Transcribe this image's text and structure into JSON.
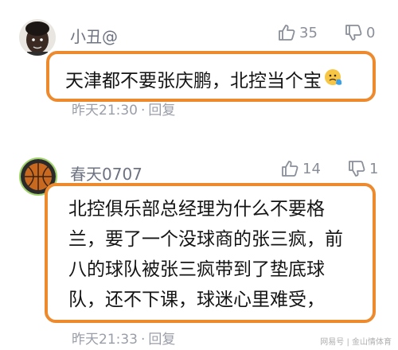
{
  "comments": [
    {
      "username": "小丑@",
      "like_count": "35",
      "dislike_count": "0",
      "text": "天津都不要张庆鹏，北控当个宝",
      "time": "昨天21:30",
      "dot": "·",
      "reply_label": "回复"
    },
    {
      "username": "春天0707",
      "like_count": "14",
      "dislike_count": "1",
      "text": "北控俱乐部总经理为什么不要格\n兰，要了一个没球商的张三疯，前\n八的球队被张三疯带到了垫底球\n队，还不下课，球迷心里难受，",
      "time": "昨天21:33",
      "dot": "·",
      "reply_label": "回复"
    }
  ],
  "watermark": "网易号 | 金山情体育",
  "colors": {
    "highlight_border": "#ee8a2e",
    "username": "#6e7382",
    "meta": "#9a9ea8"
  },
  "icons": {
    "like": "thumbs-up-icon",
    "dislike": "thumbs-down-icon",
    "emoji": "face-emoji-icon"
  }
}
